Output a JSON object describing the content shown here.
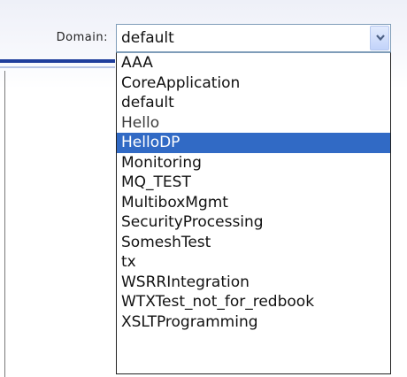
{
  "domain_field": {
    "label": "Domain:",
    "selected_value": "default",
    "dropdown_icon": "chevron-down-icon",
    "options": [
      {
        "label": "AAA"
      },
      {
        "label": "CoreApplication"
      },
      {
        "label": "default"
      },
      {
        "label": "Hello"
      },
      {
        "label": "HelloDP",
        "highlighted": true
      },
      {
        "label": "Monitoring"
      },
      {
        "label": "MQ_TEST"
      },
      {
        "label": "MultiboxMgmt"
      },
      {
        "label": "SecurityProcessing"
      },
      {
        "label": "SomeshTest"
      },
      {
        "label": "tx"
      },
      {
        "label": "WSRRIntegration"
      },
      {
        "label": "WTXTest_not_for_redbook"
      },
      {
        "label": "XSLTProgramming"
      }
    ]
  },
  "colors": {
    "highlight": "#316ac5",
    "highlight_text": "#ffffff",
    "accent_rule": "#1f3e9c",
    "select_border": "#7f9db9"
  }
}
